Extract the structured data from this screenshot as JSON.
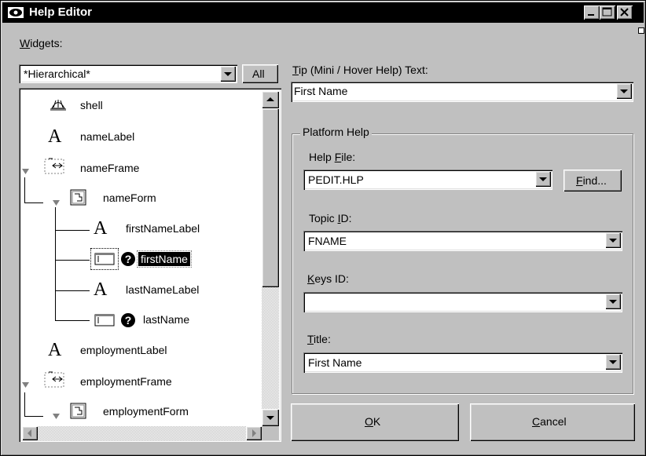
{
  "window": {
    "title": "Help Editor",
    "controls": [
      "minimize",
      "maximize",
      "close"
    ]
  },
  "widgets_panel": {
    "label": "Widgets:",
    "label_accel": "W",
    "label_rest": "idgets:",
    "filter_value": "*Hierarchical*",
    "all_button": "All",
    "tree": [
      {
        "icon": "shell-icon",
        "label": "shell",
        "depth": 0
      },
      {
        "icon": "label-a-icon",
        "label": "nameLabel",
        "depth": 0
      },
      {
        "icon": "frame-icon",
        "label": "nameFrame",
        "depth": 0,
        "expanded": true
      },
      {
        "icon": "form-icon",
        "label": "nameForm",
        "depth": 1,
        "expanded": true
      },
      {
        "icon": "label-a-icon",
        "label": "firstNameLabel",
        "depth": 2
      },
      {
        "icon": "textfield-icon",
        "label": "firstName",
        "depth": 2,
        "has_help": true,
        "selected": true
      },
      {
        "icon": "label-a-icon",
        "label": "lastNameLabel",
        "depth": 2
      },
      {
        "icon": "textfield-icon",
        "label": "lastName",
        "depth": 2,
        "has_help": true
      },
      {
        "icon": "label-a-icon",
        "label": "employmentLabel",
        "depth": 0
      },
      {
        "icon": "frame-icon",
        "label": "employmentFrame",
        "depth": 0,
        "expanded": true
      },
      {
        "icon": "form-icon",
        "label": "employmentForm",
        "depth": 1,
        "expanded": true
      }
    ]
  },
  "tip": {
    "label_accel": "T",
    "label_rest": "ip (Mini / Hover Help) Text:",
    "value": "First Name"
  },
  "platform_help": {
    "group_label": "Platform Help",
    "help_file": {
      "label_pre": "Help ",
      "label_accel": "F",
      "label_rest": "ile:",
      "value": "PEDIT.HLP"
    },
    "find_button": {
      "accel": "F",
      "rest": "ind..."
    },
    "topic_id": {
      "label_pre": "Topic ",
      "label_accel": "I",
      "label_rest": "D:",
      "value": "FNAME"
    },
    "keys_id": {
      "label_accel": "K",
      "label_rest": "eys ID:",
      "value": ""
    },
    "title": {
      "label_accel": "T",
      "label_rest": "itle:",
      "value": "First Name"
    }
  },
  "buttons": {
    "ok": {
      "accel": "O",
      "rest": "K"
    },
    "cancel": {
      "accel": "C",
      "rest": "ancel"
    }
  },
  "colors": {
    "titlebar": "#000000",
    "face": "#c0c0c0",
    "selection": "#000000"
  }
}
